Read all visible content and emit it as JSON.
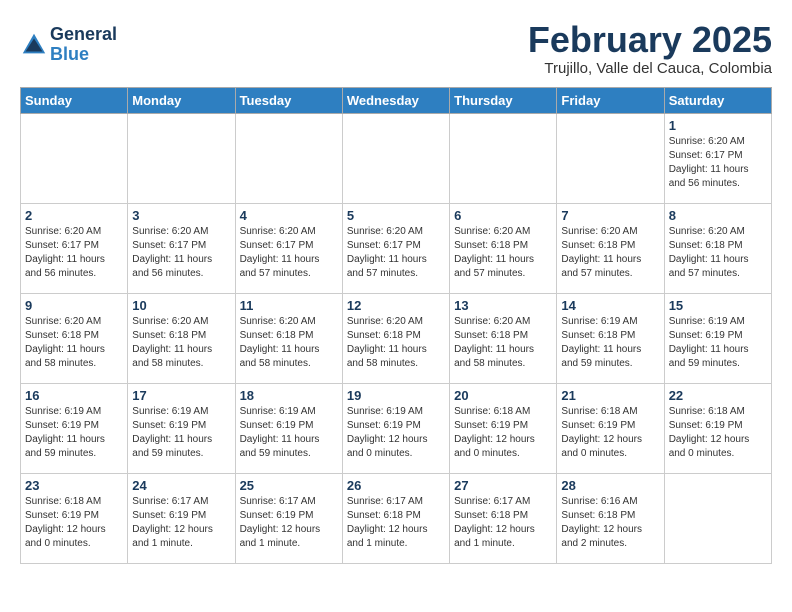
{
  "header": {
    "logo_line1": "General",
    "logo_line2": "Blue",
    "title": "February 2025",
    "subtitle": "Trujillo, Valle del Cauca, Colombia"
  },
  "days_of_week": [
    "Sunday",
    "Monday",
    "Tuesday",
    "Wednesday",
    "Thursday",
    "Friday",
    "Saturday"
  ],
  "weeks": [
    [
      {
        "day": "",
        "info": ""
      },
      {
        "day": "",
        "info": ""
      },
      {
        "day": "",
        "info": ""
      },
      {
        "day": "",
        "info": ""
      },
      {
        "day": "",
        "info": ""
      },
      {
        "day": "",
        "info": ""
      },
      {
        "day": "1",
        "info": "Sunrise: 6:20 AM\nSunset: 6:17 PM\nDaylight: 11 hours\nand 56 minutes."
      }
    ],
    [
      {
        "day": "2",
        "info": "Sunrise: 6:20 AM\nSunset: 6:17 PM\nDaylight: 11 hours\nand 56 minutes."
      },
      {
        "day": "3",
        "info": "Sunrise: 6:20 AM\nSunset: 6:17 PM\nDaylight: 11 hours\nand 56 minutes."
      },
      {
        "day": "4",
        "info": "Sunrise: 6:20 AM\nSunset: 6:17 PM\nDaylight: 11 hours\nand 57 minutes."
      },
      {
        "day": "5",
        "info": "Sunrise: 6:20 AM\nSunset: 6:17 PM\nDaylight: 11 hours\nand 57 minutes."
      },
      {
        "day": "6",
        "info": "Sunrise: 6:20 AM\nSunset: 6:18 PM\nDaylight: 11 hours\nand 57 minutes."
      },
      {
        "day": "7",
        "info": "Sunrise: 6:20 AM\nSunset: 6:18 PM\nDaylight: 11 hours\nand 57 minutes."
      },
      {
        "day": "8",
        "info": "Sunrise: 6:20 AM\nSunset: 6:18 PM\nDaylight: 11 hours\nand 57 minutes."
      }
    ],
    [
      {
        "day": "9",
        "info": "Sunrise: 6:20 AM\nSunset: 6:18 PM\nDaylight: 11 hours\nand 58 minutes."
      },
      {
        "day": "10",
        "info": "Sunrise: 6:20 AM\nSunset: 6:18 PM\nDaylight: 11 hours\nand 58 minutes."
      },
      {
        "day": "11",
        "info": "Sunrise: 6:20 AM\nSunset: 6:18 PM\nDaylight: 11 hours\nand 58 minutes."
      },
      {
        "day": "12",
        "info": "Sunrise: 6:20 AM\nSunset: 6:18 PM\nDaylight: 11 hours\nand 58 minutes."
      },
      {
        "day": "13",
        "info": "Sunrise: 6:20 AM\nSunset: 6:18 PM\nDaylight: 11 hours\nand 58 minutes."
      },
      {
        "day": "14",
        "info": "Sunrise: 6:19 AM\nSunset: 6:18 PM\nDaylight: 11 hours\nand 59 minutes."
      },
      {
        "day": "15",
        "info": "Sunrise: 6:19 AM\nSunset: 6:19 PM\nDaylight: 11 hours\nand 59 minutes."
      }
    ],
    [
      {
        "day": "16",
        "info": "Sunrise: 6:19 AM\nSunset: 6:19 PM\nDaylight: 11 hours\nand 59 minutes."
      },
      {
        "day": "17",
        "info": "Sunrise: 6:19 AM\nSunset: 6:19 PM\nDaylight: 11 hours\nand 59 minutes."
      },
      {
        "day": "18",
        "info": "Sunrise: 6:19 AM\nSunset: 6:19 PM\nDaylight: 11 hours\nand 59 minutes."
      },
      {
        "day": "19",
        "info": "Sunrise: 6:19 AM\nSunset: 6:19 PM\nDaylight: 12 hours\nand 0 minutes."
      },
      {
        "day": "20",
        "info": "Sunrise: 6:18 AM\nSunset: 6:19 PM\nDaylight: 12 hours\nand 0 minutes."
      },
      {
        "day": "21",
        "info": "Sunrise: 6:18 AM\nSunset: 6:19 PM\nDaylight: 12 hours\nand 0 minutes."
      },
      {
        "day": "22",
        "info": "Sunrise: 6:18 AM\nSunset: 6:19 PM\nDaylight: 12 hours\nand 0 minutes."
      }
    ],
    [
      {
        "day": "23",
        "info": "Sunrise: 6:18 AM\nSunset: 6:19 PM\nDaylight: 12 hours\nand 0 minutes."
      },
      {
        "day": "24",
        "info": "Sunrise: 6:17 AM\nSunset: 6:19 PM\nDaylight: 12 hours\nand 1 minute."
      },
      {
        "day": "25",
        "info": "Sunrise: 6:17 AM\nSunset: 6:19 PM\nDaylight: 12 hours\nand 1 minute."
      },
      {
        "day": "26",
        "info": "Sunrise: 6:17 AM\nSunset: 6:18 PM\nDaylight: 12 hours\nand 1 minute."
      },
      {
        "day": "27",
        "info": "Sunrise: 6:17 AM\nSunset: 6:18 PM\nDaylight: 12 hours\nand 1 minute."
      },
      {
        "day": "28",
        "info": "Sunrise: 6:16 AM\nSunset: 6:18 PM\nDaylight: 12 hours\nand 2 minutes."
      },
      {
        "day": "",
        "info": ""
      }
    ]
  ]
}
